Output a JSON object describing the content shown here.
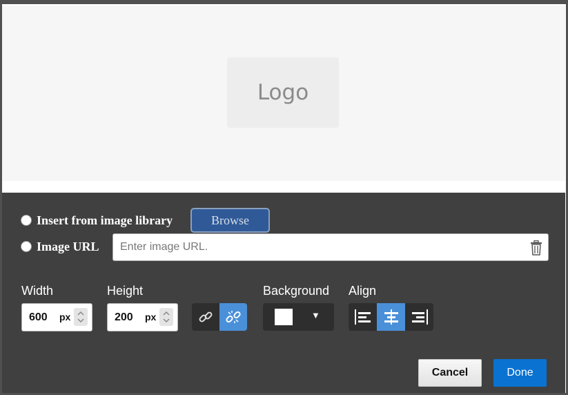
{
  "preview": {
    "logo_text": "Logo"
  },
  "source": {
    "library_label": "Insert from image library",
    "browse_label": "Browse",
    "url_label": "Image URL",
    "url_placeholder": "Enter image URL.",
    "url_value": ""
  },
  "dimensions": {
    "width_label": "Width",
    "width_value": "600",
    "width_unit": "px",
    "height_label": "Height",
    "height_value": "200",
    "height_unit": "px",
    "lock_aspect_icons": [
      "link-icon",
      "unlink-icon"
    ],
    "active_lock": "unlink-icon"
  },
  "background": {
    "label": "Background",
    "color": "#ffffff"
  },
  "align": {
    "label": "Align",
    "options": [
      "align-left-icon",
      "align-center-icon",
      "align-right-icon"
    ],
    "active": "align-center-icon"
  },
  "actions": {
    "cancel_label": "Cancel",
    "done_label": "Done"
  },
  "colors": {
    "panel_bg": "#404040",
    "accent_active": "#4a90d9",
    "done_blue": "#0a72d1",
    "browse_blue": "#2f5a97"
  }
}
